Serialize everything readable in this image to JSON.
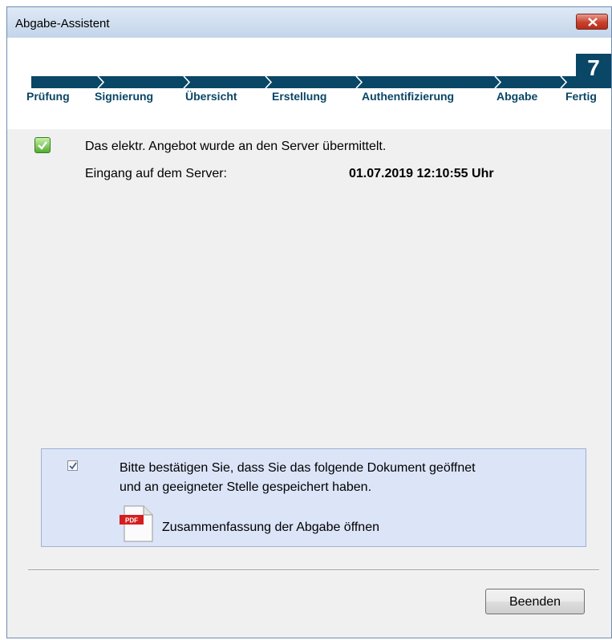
{
  "window": {
    "title": "Abgabe-Assistent"
  },
  "wizard": {
    "step_number": "7",
    "steps": [
      "Prüfung",
      "Signierung",
      "Übersicht",
      "Erstellung",
      "Authentifizierung",
      "Abgabe",
      "Fertig"
    ],
    "accent_color": "#0a4666"
  },
  "status": {
    "icon": "success-check-icon",
    "message": "Das elektr. Angebot wurde an den Server übermittelt.",
    "received_label": "Eingang auf dem Server:",
    "received_value": "01.07.2019 12:10:55 Uhr"
  },
  "confirmation": {
    "checked": true,
    "line1": "Bitte bestätigen Sie, dass Sie das folgende Dokument geöffnet",
    "line2": "und an geeigneter Stelle gespeichert haben.",
    "pdf_icon_label": "PDF",
    "pdf_link": "Zusammenfassung der Abgabe öffnen"
  },
  "footer": {
    "finish_button": "Beenden"
  }
}
